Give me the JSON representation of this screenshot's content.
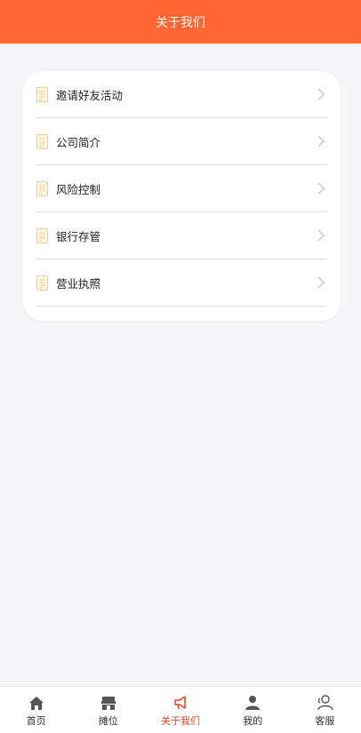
{
  "header": {
    "title": "关于我们"
  },
  "menu": {
    "items": [
      {
        "label": "邀请好友活动",
        "icon": "document-icon"
      },
      {
        "label": "公司简介",
        "icon": "document-icon"
      },
      {
        "label": "风险控制",
        "icon": "document-icon"
      },
      {
        "label": "银行存管",
        "icon": "document-icon"
      },
      {
        "label": "营业执照",
        "icon": "document-icon"
      }
    ]
  },
  "tabbar": {
    "active": 2,
    "tabs": [
      {
        "label": "首页",
        "icon": "home-icon"
      },
      {
        "label": "摊位",
        "icon": "shop-icon"
      },
      {
        "label": "关于我们",
        "icon": "megaphone-icon"
      },
      {
        "label": "我的",
        "icon": "user-icon"
      },
      {
        "label": "客服",
        "icon": "customer-service-icon"
      }
    ]
  },
  "colors": {
    "brand": "#ff6633",
    "active_tab": "#ea4325",
    "background": "#f5f4f7"
  }
}
